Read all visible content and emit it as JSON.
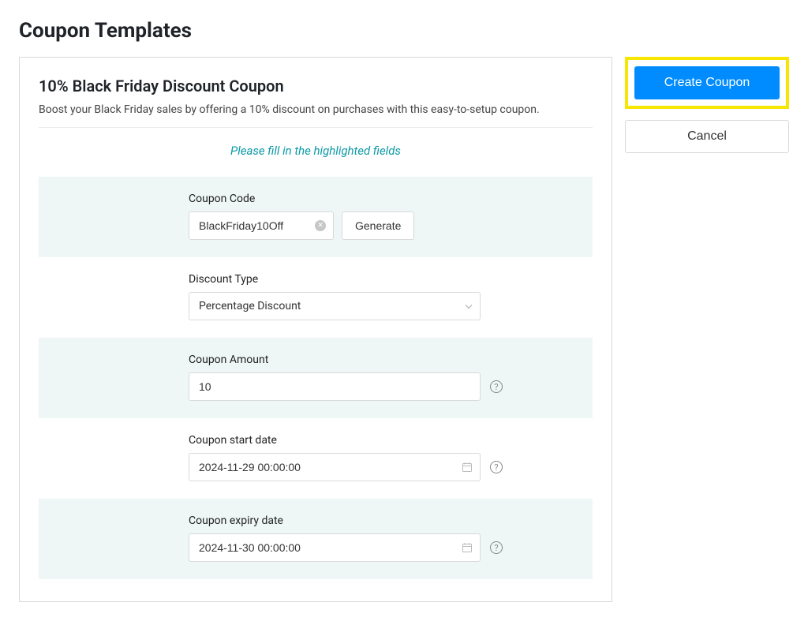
{
  "page_title": "Coupon Templates",
  "template": {
    "title": "10% Black Friday Discount Coupon",
    "description": "Boost your Black Friday sales by offering a 10% discount on purchases with this easy-to-setup coupon.",
    "validation_message": "Please fill in the highlighted fields"
  },
  "fields": {
    "coupon_code": {
      "label": "Coupon Code",
      "value": "BlackFriday10Off",
      "generate_label": "Generate"
    },
    "discount_type": {
      "label": "Discount Type",
      "value": "Percentage Discount"
    },
    "coupon_amount": {
      "label": "Coupon Amount",
      "value": "10"
    },
    "start_date": {
      "label": "Coupon start date",
      "value": "2024-11-29 00:00:00"
    },
    "expiry_date": {
      "label": "Coupon expiry date",
      "value": "2024-11-30 00:00:00"
    }
  },
  "actions": {
    "create_label": "Create Coupon",
    "cancel_label": "Cancel"
  }
}
